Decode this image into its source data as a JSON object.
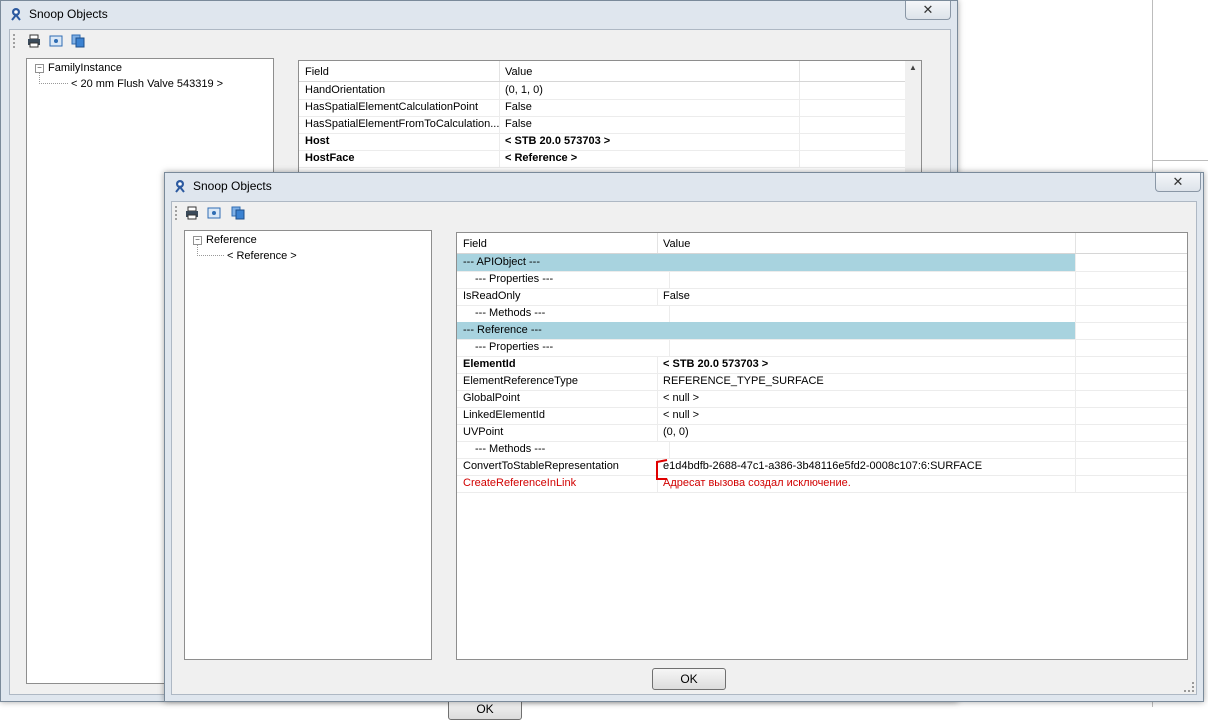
{
  "back_window": {
    "title": "Snoop Objects",
    "close_label": "✕",
    "tree": {
      "root": "FamilyInstance",
      "child": "< 20 mm Flush Valve  543319 >"
    },
    "grid": {
      "headers": [
        "Field",
        "Value"
      ],
      "rows": [
        {
          "field": "HandOrientation",
          "value": "(0, 1, 0)",
          "style": "normal"
        },
        {
          "field": "HasSpatialElementCalculationPoint",
          "value": "False",
          "style": "normal"
        },
        {
          "field": "HasSpatialElementFromToCalculation...",
          "value": "False",
          "style": "normal"
        },
        {
          "field": "Host",
          "value": "< STB 20.0  573703 >",
          "style": "bold"
        },
        {
          "field": "HostFace",
          "value": "< Reference >",
          "style": "bold"
        }
      ]
    },
    "ok_label": "OK"
  },
  "front_window": {
    "title": "Snoop Objects",
    "close_label": "✕",
    "tree": {
      "root": "Reference",
      "child": "< Reference >"
    },
    "grid": {
      "headers": [
        "Field",
        "Value"
      ],
      "rows": [
        {
          "field": "--- APIObject ---",
          "value": "",
          "style": "section"
        },
        {
          "field": "  --- Properties ---",
          "value": "",
          "style": "sub"
        },
        {
          "field": "IsReadOnly",
          "value": "False",
          "style": "normal"
        },
        {
          "field": "  --- Methods ---",
          "value": "",
          "style": "sub"
        },
        {
          "field": "--- Reference ---",
          "value": "",
          "style": "section"
        },
        {
          "field": "  --- Properties ---",
          "value": "",
          "style": "sub"
        },
        {
          "field": "ElementId",
          "value": "< STB 20.0  573703 >",
          "style": "bold"
        },
        {
          "field": "ElementReferenceType",
          "value": "REFERENCE_TYPE_SURFACE",
          "style": "normal"
        },
        {
          "field": "GlobalPoint",
          "value": "< null >",
          "style": "normal"
        },
        {
          "field": "LinkedElementId",
          "value": "< null >",
          "style": "normal"
        },
        {
          "field": "UVPoint",
          "value": "(0, 0)",
          "style": "normal"
        },
        {
          "field": "  --- Methods ---",
          "value": "",
          "style": "sub"
        },
        {
          "field": "ConvertToStableRepresentation",
          "value": "e1d4bdfb-2688-47c1-a386-3b48116e5fd2-0008c107:6:SURFACE",
          "style": "normal"
        },
        {
          "field": "CreateReferenceInLink",
          "value": "Адресат вызова создал исключение.",
          "style": "err"
        }
      ]
    },
    "ok_label": "OK"
  },
  "colors": {
    "section_row": "#a8d3df",
    "error_text": "#d10000",
    "annotation_bracket": "#e00000"
  }
}
